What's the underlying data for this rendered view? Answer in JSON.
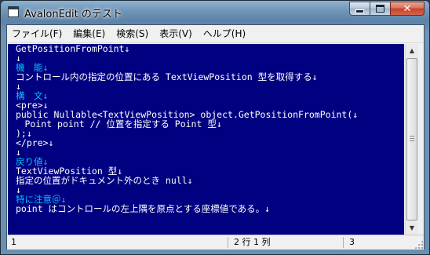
{
  "window": {
    "title": "AvalonEdit のテスト",
    "minimize_glyph": "",
    "maximize_glyph": "",
    "close_glyph": "✕"
  },
  "menu": {
    "items": [
      {
        "label": "ファイル(F)"
      },
      {
        "label": "編集(E)"
      },
      {
        "label": "検索(S)"
      },
      {
        "label": "表示(V)"
      },
      {
        "label": "ヘルプ(H)"
      }
    ]
  },
  "editor": {
    "background": "#000080",
    "text_color": "#ffffff",
    "heading_color": "#00c0ff",
    "eol_marker": "↓",
    "lines": [
      {
        "text": "GetPositionFromPoint",
        "heading": false
      },
      {
        "text": "",
        "heading": false
      },
      {
        "text": "機　能",
        "heading": true
      },
      {
        "text": "コントロール内の指定の位置にある TextViewPosition 型を取得する",
        "heading": false
      },
      {
        "text": "",
        "heading": false
      },
      {
        "text": "構　文",
        "heading": true
      },
      {
        "text": "<pre>",
        "heading": false
      },
      {
        "text": "public Nullable<TextViewPosition> object.GetPositionFromPoint(",
        "heading": false
      },
      {
        "text": "　Point point // 位置を指定する Point 型",
        "heading": false
      },
      {
        "text": ");",
        "heading": false
      },
      {
        "text": "</pre>",
        "heading": false
      },
      {
        "text": "",
        "heading": false
      },
      {
        "text": "戻り値",
        "heading": true
      },
      {
        "text": "TextViewPosition 型",
        "heading": false
      },
      {
        "text": "指定の位置がドキュメント外のとき null",
        "heading": false
      },
      {
        "text": "",
        "heading": false
      },
      {
        "text": "特に注意＠",
        "heading": true
      },
      {
        "text": "point はコントロールの左上隅を原点とする座標値である。",
        "heading": false
      }
    ]
  },
  "scrollbar": {
    "up_arrow": "▲",
    "down_arrow": "▼"
  },
  "status": {
    "cell1": "1",
    "cell2": "2 行 1 列",
    "cell3": "3"
  }
}
